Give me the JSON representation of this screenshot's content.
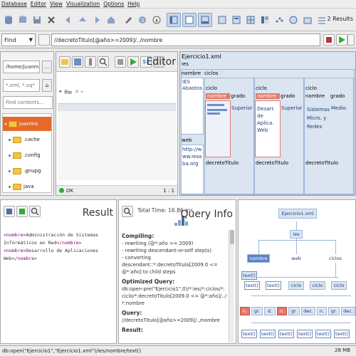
{
  "menu": [
    "Database",
    "Editor",
    "View",
    "Visualization",
    "Options",
    "Help"
  ],
  "results_count": "2 Results",
  "find": {
    "mode": "Find",
    "query": "//decretoTitulo[@año>=2009]/../nombre"
  },
  "browser": {
    "path": "/home/juanma/",
    "filter": "*.xml, *.xq*",
    "contents_placeholder": "Find contents...",
    "btn": "...",
    "tree": [
      "juanma",
      ".cache",
      ".config",
      ".gnupg",
      "java"
    ]
  },
  "editor": {
    "title": "Editor",
    "file_label": "file",
    "status": "OK",
    "position": "1 : 1"
  },
  "table": {
    "doc": "Ejercicio1.xml",
    "ies": "ies",
    "nombre_hdr": "nombre",
    "ciclos_hdr": "ciclos",
    "ies_name": "IES Abastos",
    "web_hdr": "web",
    "web_val": "http://www.iesaba.org",
    "ciclo": "ciclo",
    "nombre": "nombre",
    "grado": "grado",
    "cols": [
      {
        "nombre": "",
        "grado": "Superior"
      },
      {
        "nombre": "Desarr. de Aplica. Web",
        "grado": "Superior"
      },
      {
        "nombre": "Sistemas Micro. y Redes",
        "grado": "Medio"
      }
    ],
    "decreto": "decretoTitulo"
  },
  "result": {
    "title": "Result",
    "lines": [
      {
        "open": "<nombre>",
        "text": "Administración de Sistemas Informáticos en Red",
        "close": "</nombre>"
      },
      {
        "open": "<nombre>",
        "text": "Desarrollo de Aplicaciones Web",
        "close": "</nombre>"
      }
    ]
  },
  "queryinfo": {
    "title": "Query Info",
    "total_time": "Total Time: 16.86 ms",
    "compiling_h": "Compiling:",
    "compiling": [
      "- rewriting (@*:año >= 2009)",
      "- rewriting descendant-or-self step(s)",
      "- converting descendant::*:decretoTitulo[2009.0 <= @*:año] to child steps"
    ],
    "optimized_h": "Optimized Query:",
    "optimized": "db:open-pre(\"Ejercicio1\",0)/*:ies/*:ciclos/*:ciclo/*:decretoTitulo[2009.0 <= @*:año]/../*:nombre",
    "query_h": "Query:",
    "query": "//decretoTitulo[@año>=2009]/../nombre",
    "result_h": "Result:"
  },
  "graph": {
    "root": "Ejercicio1.xml",
    "ies": "ies",
    "level2": [
      "nombre",
      "web",
      "ciclos"
    ],
    "text": "text()",
    "ciclo": "ciclo",
    "row4": [
      "n.",
      "gr.",
      "d.",
      "n.",
      "gr.",
      "dec.",
      "n.",
      "gr.",
      "dec."
    ]
  },
  "status": {
    "text": "db:open(\"Ejercicio1\",\"Ejercicio1.xml\")/ies/nombre/text()",
    "memory": "28 MB"
  }
}
